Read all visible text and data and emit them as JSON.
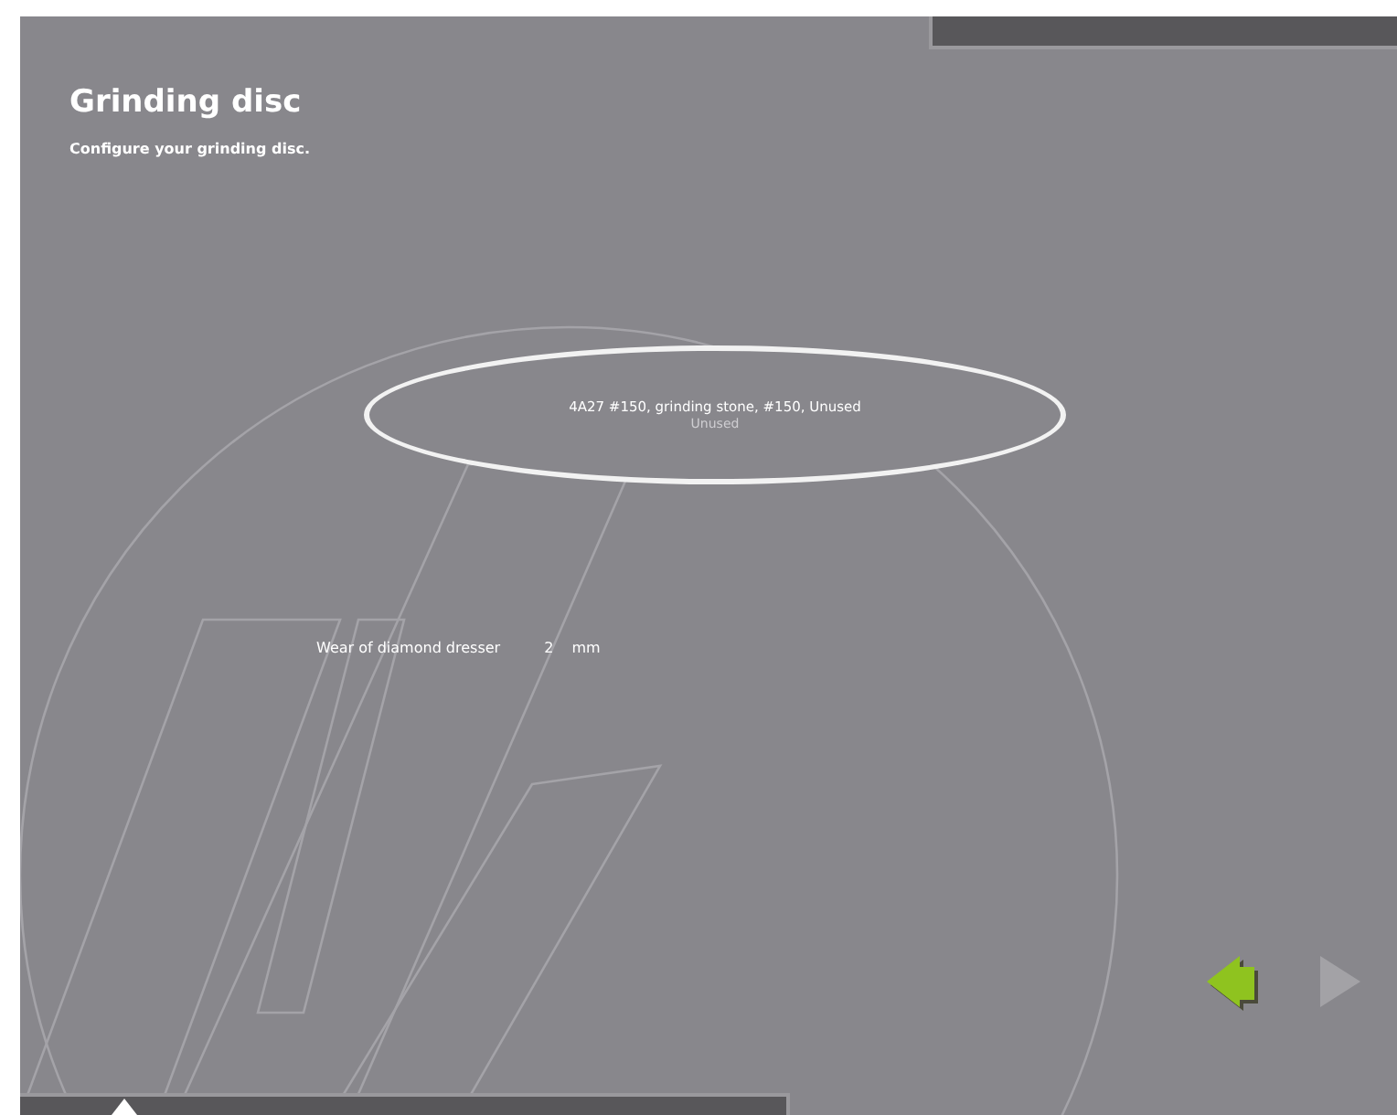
{
  "title": "Grinding disc",
  "subtitle": "Configure your grinding disc.",
  "selector": {
    "label": "4A27 #150, grinding stone, #150, Unused",
    "sublabel": "Unused"
  },
  "fields": [
    {
      "label": "Wear of diamond dresser",
      "value": "2",
      "unit": "mm"
    }
  ],
  "navigation": [
    {
      "kind": "back",
      "disabled": false
    },
    {
      "kind": "forward",
      "disabled": true
    }
  ]
}
